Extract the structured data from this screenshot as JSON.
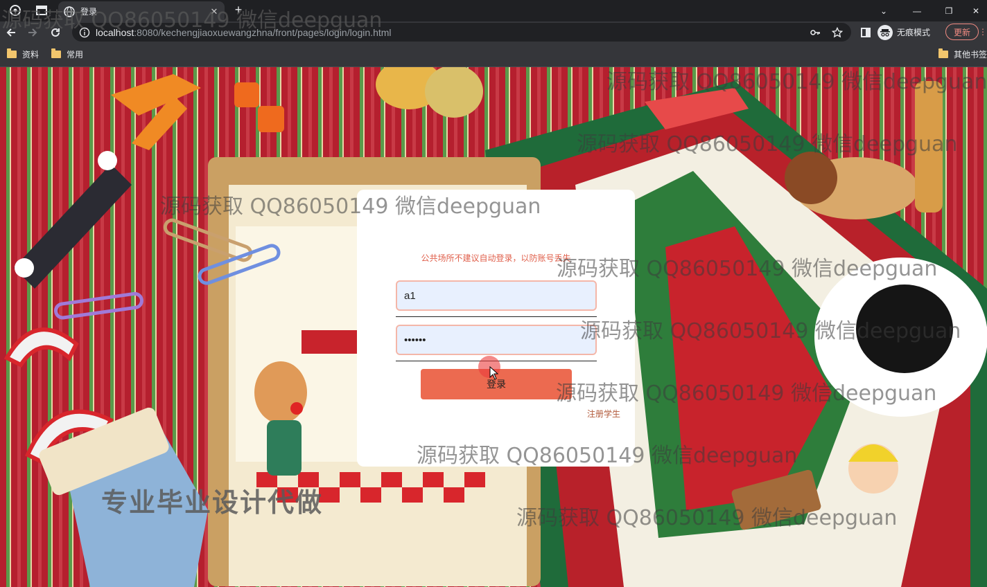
{
  "browser": {
    "tab_title": "登录",
    "url_host": "localhost",
    "url_rest": ":8080/kechengjiaoxuewangzhna/front/pages/login/login.html",
    "incognito_label": "无痕模式",
    "update_label": "更新",
    "bookmarks": [
      "资料",
      "常用"
    ],
    "other_bookmarks": "其他书签"
  },
  "login": {
    "notice": "公共场所不建议自动登录，以防账号丢失",
    "username_value": "a1",
    "password_value": "••••••",
    "login_button": "登录",
    "register_link": "注册学生"
  },
  "overlay": {
    "watermark": "源码获取 QQ86050149 微信deepguan",
    "promo": "专业毕业设计代做"
  }
}
